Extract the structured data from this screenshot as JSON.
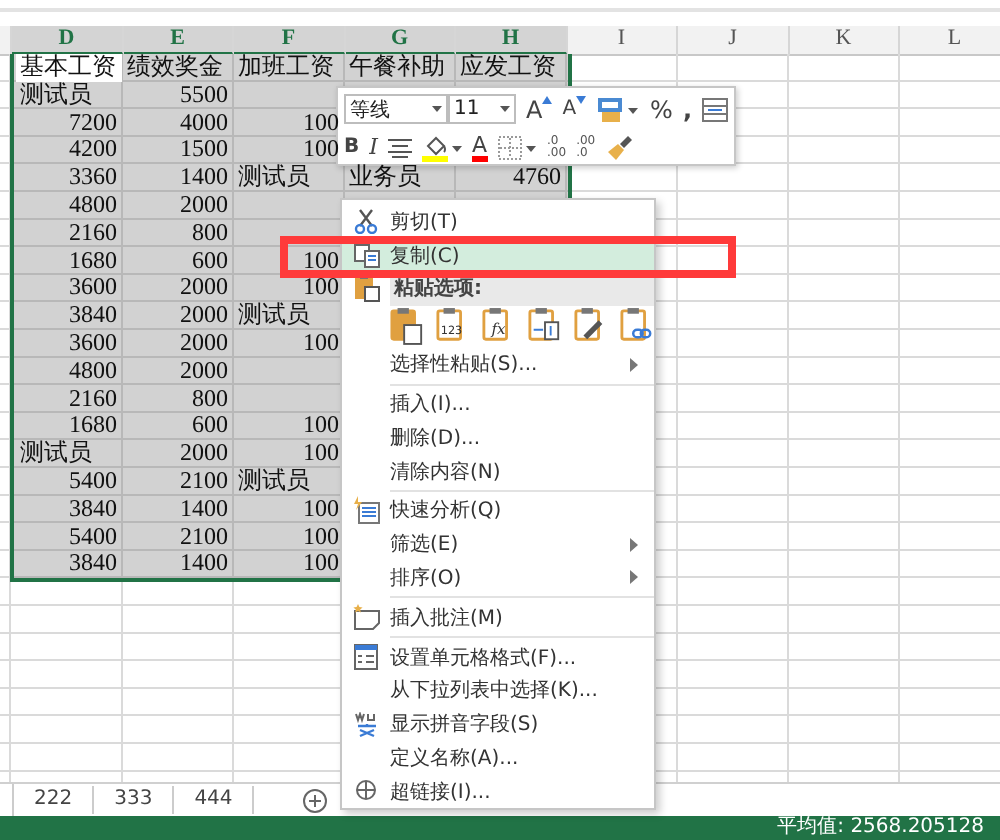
{
  "sheet": {
    "columns": [
      {
        "label": "D",
        "selected": true
      },
      {
        "label": "E",
        "selected": true
      },
      {
        "label": "F",
        "selected": true
      },
      {
        "label": "G",
        "selected": true
      },
      {
        "label": "H",
        "selected": true
      },
      {
        "label": "I",
        "selected": false
      },
      {
        "label": "J",
        "selected": false
      },
      {
        "label": "K",
        "selected": false
      },
      {
        "label": "L",
        "selected": false
      }
    ],
    "rows": [
      {
        "cells": [
          "基本工资",
          "绩效奖金",
          "加班工资",
          "午餐补助",
          "应发工资"
        ],
        "first_cell_active": true
      },
      {
        "cells": [
          "测试员",
          "5500",
          null,
          null,
          null
        ]
      },
      {
        "cells": [
          "7200",
          "4000",
          "100",
          null,
          null
        ]
      },
      {
        "cells": [
          "4200",
          "1500",
          "100",
          null,
          null
        ]
      },
      {
        "cells": [
          "3360",
          "1400",
          "测试员",
          "业务员",
          "4760"
        ]
      },
      {
        "cells": [
          "4800",
          "2000",
          null,
          null,
          null
        ]
      },
      {
        "cells": [
          "2160",
          "800",
          null,
          null,
          null
        ]
      },
      {
        "cells": [
          "1680",
          "600",
          "100",
          null,
          null
        ]
      },
      {
        "cells": [
          "3600",
          "2000",
          "100",
          null,
          null
        ]
      },
      {
        "cells": [
          "3840",
          "2000",
          "测试员",
          null,
          null
        ]
      },
      {
        "cells": [
          "3600",
          "2000",
          "100",
          null,
          null
        ]
      },
      {
        "cells": [
          "4800",
          "2000",
          null,
          null,
          null
        ]
      },
      {
        "cells": [
          "2160",
          "800",
          null,
          null,
          null
        ]
      },
      {
        "cells": [
          "1680",
          "600",
          "100",
          null,
          null
        ]
      },
      {
        "cells": [
          "测试员",
          "2000",
          "100",
          null,
          null
        ]
      },
      {
        "cells": [
          "5400",
          "2100",
          "测试员",
          null,
          null
        ]
      },
      {
        "cells": [
          "3840",
          "1400",
          "100",
          null,
          null
        ]
      },
      {
        "cells": [
          "5400",
          "2100",
          "100",
          null,
          null
        ]
      },
      {
        "cells": [
          "3840",
          "1400",
          "100",
          null,
          null
        ]
      }
    ]
  },
  "mini_toolbar": {
    "font": "等线",
    "size": "11",
    "row1": [
      {
        "kind": "grow-font",
        "label": "A"
      },
      {
        "kind": "shrink-font",
        "label": "A"
      },
      {
        "kind": "table-style"
      },
      {
        "kind": "percent",
        "label": "%"
      },
      {
        "kind": "comma",
        "label": ","
      },
      {
        "kind": "merge"
      }
    ],
    "row2": [
      {
        "kind": "bold",
        "label": "B"
      },
      {
        "kind": "italic",
        "label": "I"
      },
      {
        "kind": "align"
      },
      {
        "kind": "fill-color"
      },
      {
        "kind": "font-color",
        "label": "A"
      },
      {
        "kind": "borders"
      },
      {
        "kind": "decimal-increase",
        "label": ".0",
        "sub": ".00"
      },
      {
        "kind": "decimal-decrease",
        "label": ".00",
        "sub": ".0"
      },
      {
        "kind": "format-painter"
      }
    ]
  },
  "context_menu": [
    {
      "kind": "cut",
      "label": "剪切(T)",
      "selected": false,
      "submenu": false
    },
    {
      "kind": "copy",
      "label": "复制(C)",
      "selected": true,
      "submenu": false
    },
    {
      "kind": "paste-header",
      "label": "粘贴选项:"
    },
    {
      "kind": "paste-options",
      "options": [
        {
          "kind": "paste"
        },
        {
          "kind": "values",
          "label": "123"
        },
        {
          "kind": "formulas",
          "label": "fx"
        },
        {
          "kind": "transpose"
        },
        {
          "kind": "formatting"
        },
        {
          "kind": "link"
        }
      ]
    },
    {
      "kind": "command",
      "label": "选择性粘贴(S)...",
      "selected": false,
      "submenu": true
    },
    {
      "kind": "separator"
    },
    {
      "kind": "command",
      "label": "插入(I)...",
      "selected": false,
      "submenu": false
    },
    {
      "kind": "command",
      "label": "删除(D)...",
      "selected": false,
      "submenu": false
    },
    {
      "kind": "command",
      "label": "清除内容(N)",
      "selected": false,
      "submenu": false
    },
    {
      "kind": "separator"
    },
    {
      "kind": "quick-analysis",
      "label": "快速分析(Q)",
      "selected": false,
      "submenu": false
    },
    {
      "kind": "command",
      "label": "筛选(E)",
      "selected": false,
      "submenu": true
    },
    {
      "kind": "command",
      "label": "排序(O)",
      "selected": false,
      "submenu": true
    },
    {
      "kind": "separator"
    },
    {
      "kind": "comment",
      "label": "插入批注(M)",
      "selected": false,
      "submenu": false
    },
    {
      "kind": "separator"
    },
    {
      "kind": "format-cells",
      "label": "设置单元格格式(F)...",
      "selected": false,
      "submenu": false
    },
    {
      "kind": "command",
      "label": "从下拉列表中选择(K)...",
      "selected": false,
      "submenu": false
    },
    {
      "kind": "phonetic",
      "label": "显示拼音字段(S)",
      "selected": false,
      "submenu": false
    },
    {
      "kind": "command",
      "label": "定义名称(A)...",
      "selected": false,
      "submenu": false
    },
    {
      "kind": "hyperlink",
      "label": "超链接(I)...",
      "selected": false,
      "submenu": false
    }
  ],
  "sheet_tabs": [
    {
      "label": "222"
    },
    {
      "label": "333"
    },
    {
      "label": "444"
    }
  ],
  "status_bar": {
    "average": "平均值: 2568.205128"
  }
}
